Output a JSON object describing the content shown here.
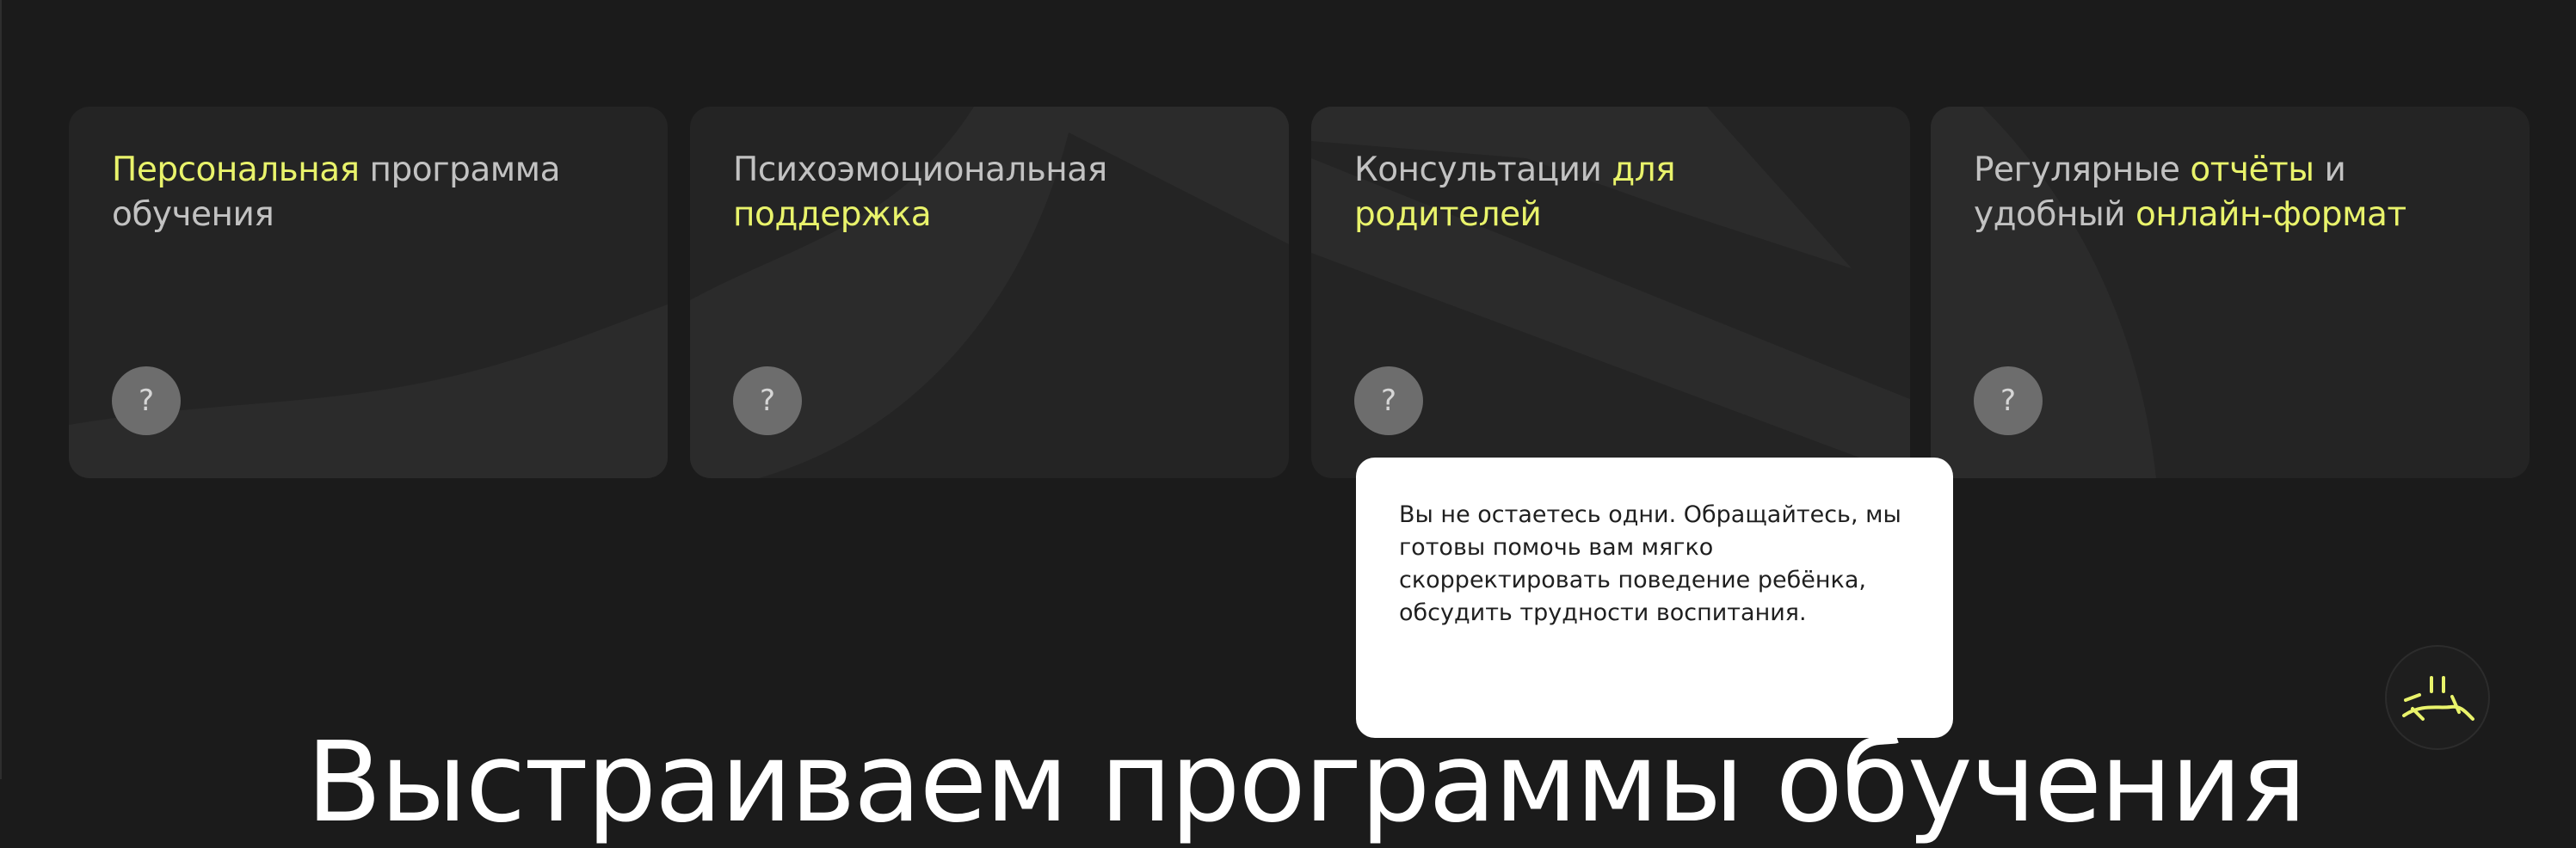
{
  "cards": [
    {
      "title_parts": [
        {
          "text": "Персональная",
          "highlight": true
        },
        {
          "text": " программа обучения",
          "highlight": false
        }
      ],
      "help_label": "?"
    },
    {
      "title_parts": [
        {
          "text": "Психоэмоциональная ",
          "highlight": false
        },
        {
          "text": "поддержка",
          "highlight": true
        }
      ],
      "help_label": "?"
    },
    {
      "title_parts": [
        {
          "text": "Консультации ",
          "highlight": false
        },
        {
          "text": "для родителей",
          "highlight": true
        }
      ],
      "help_label": "?"
    },
    {
      "title_parts": [
        {
          "text": "Регулярные ",
          "highlight": false
        },
        {
          "text": "отчёты",
          "highlight": true
        },
        {
          "text": " и удобный ",
          "highlight": false
        },
        {
          "text": "онлайн-формат",
          "highlight": true
        }
      ],
      "help_label": "?"
    }
  ],
  "tooltip": {
    "text": "Вы не остаетесь одни. Обращайтесь, мы готовы помочь вам мягко скорректировать поведение ребёнка, обсудить трудности воспитания."
  },
  "section_heading": "Выстраиваем программы обучения",
  "colors": {
    "background": "#1b1b1b",
    "card": "#242424",
    "card_shape": "#2b2b2b",
    "accent": "#e9f36b",
    "text_muted": "#c2c2c2",
    "help_button": "#6d6d6d"
  },
  "icons": {
    "help": "question-mark-icon",
    "mascot": "smiley-mascot-icon"
  }
}
